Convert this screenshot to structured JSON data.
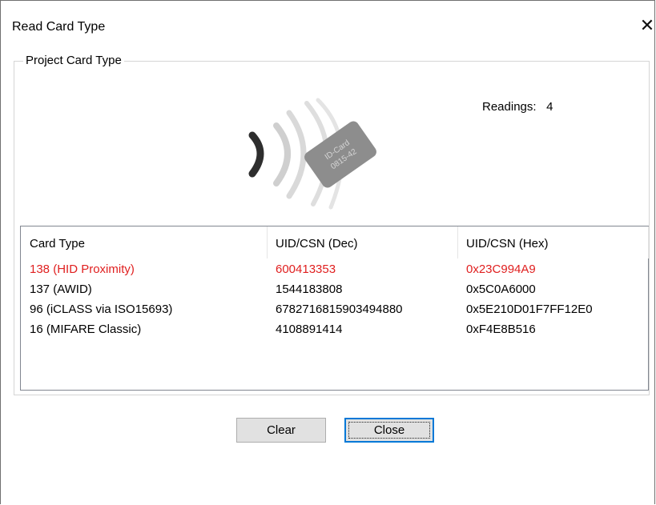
{
  "window": {
    "title": "Read Card Type"
  },
  "group": {
    "legend": "Project Card Type"
  },
  "readings": {
    "label": "Readings:",
    "value": "4"
  },
  "card_image": {
    "line1": "ID-Card",
    "line2": "0815-42"
  },
  "table": {
    "columns": [
      "Card Type",
      "UID/CSN (Dec)",
      "UID/CSN (Hex)"
    ],
    "rows": [
      {
        "type": "138 (HID Proximity)",
        "dec": "600413353",
        "hex": "0x23C994A9",
        "highlight": true
      },
      {
        "type": "137 (AWID)",
        "dec": "1544183808",
        "hex": "0x5C0A6000",
        "highlight": false
      },
      {
        "type": "96 (iCLASS via ISO15693)",
        "dec": "6782716815903494880",
        "hex": "0x5E210D01F7FF12E0",
        "highlight": false
      },
      {
        "type": "16 (MIFARE Classic)",
        "dec": "4108891414",
        "hex": "0xF4E8B516",
        "highlight": false
      }
    ]
  },
  "buttons": {
    "clear": "Clear",
    "close": "Close"
  },
  "colors": {
    "highlight_row": "#e02020",
    "default_button_border": "#0078d7"
  }
}
